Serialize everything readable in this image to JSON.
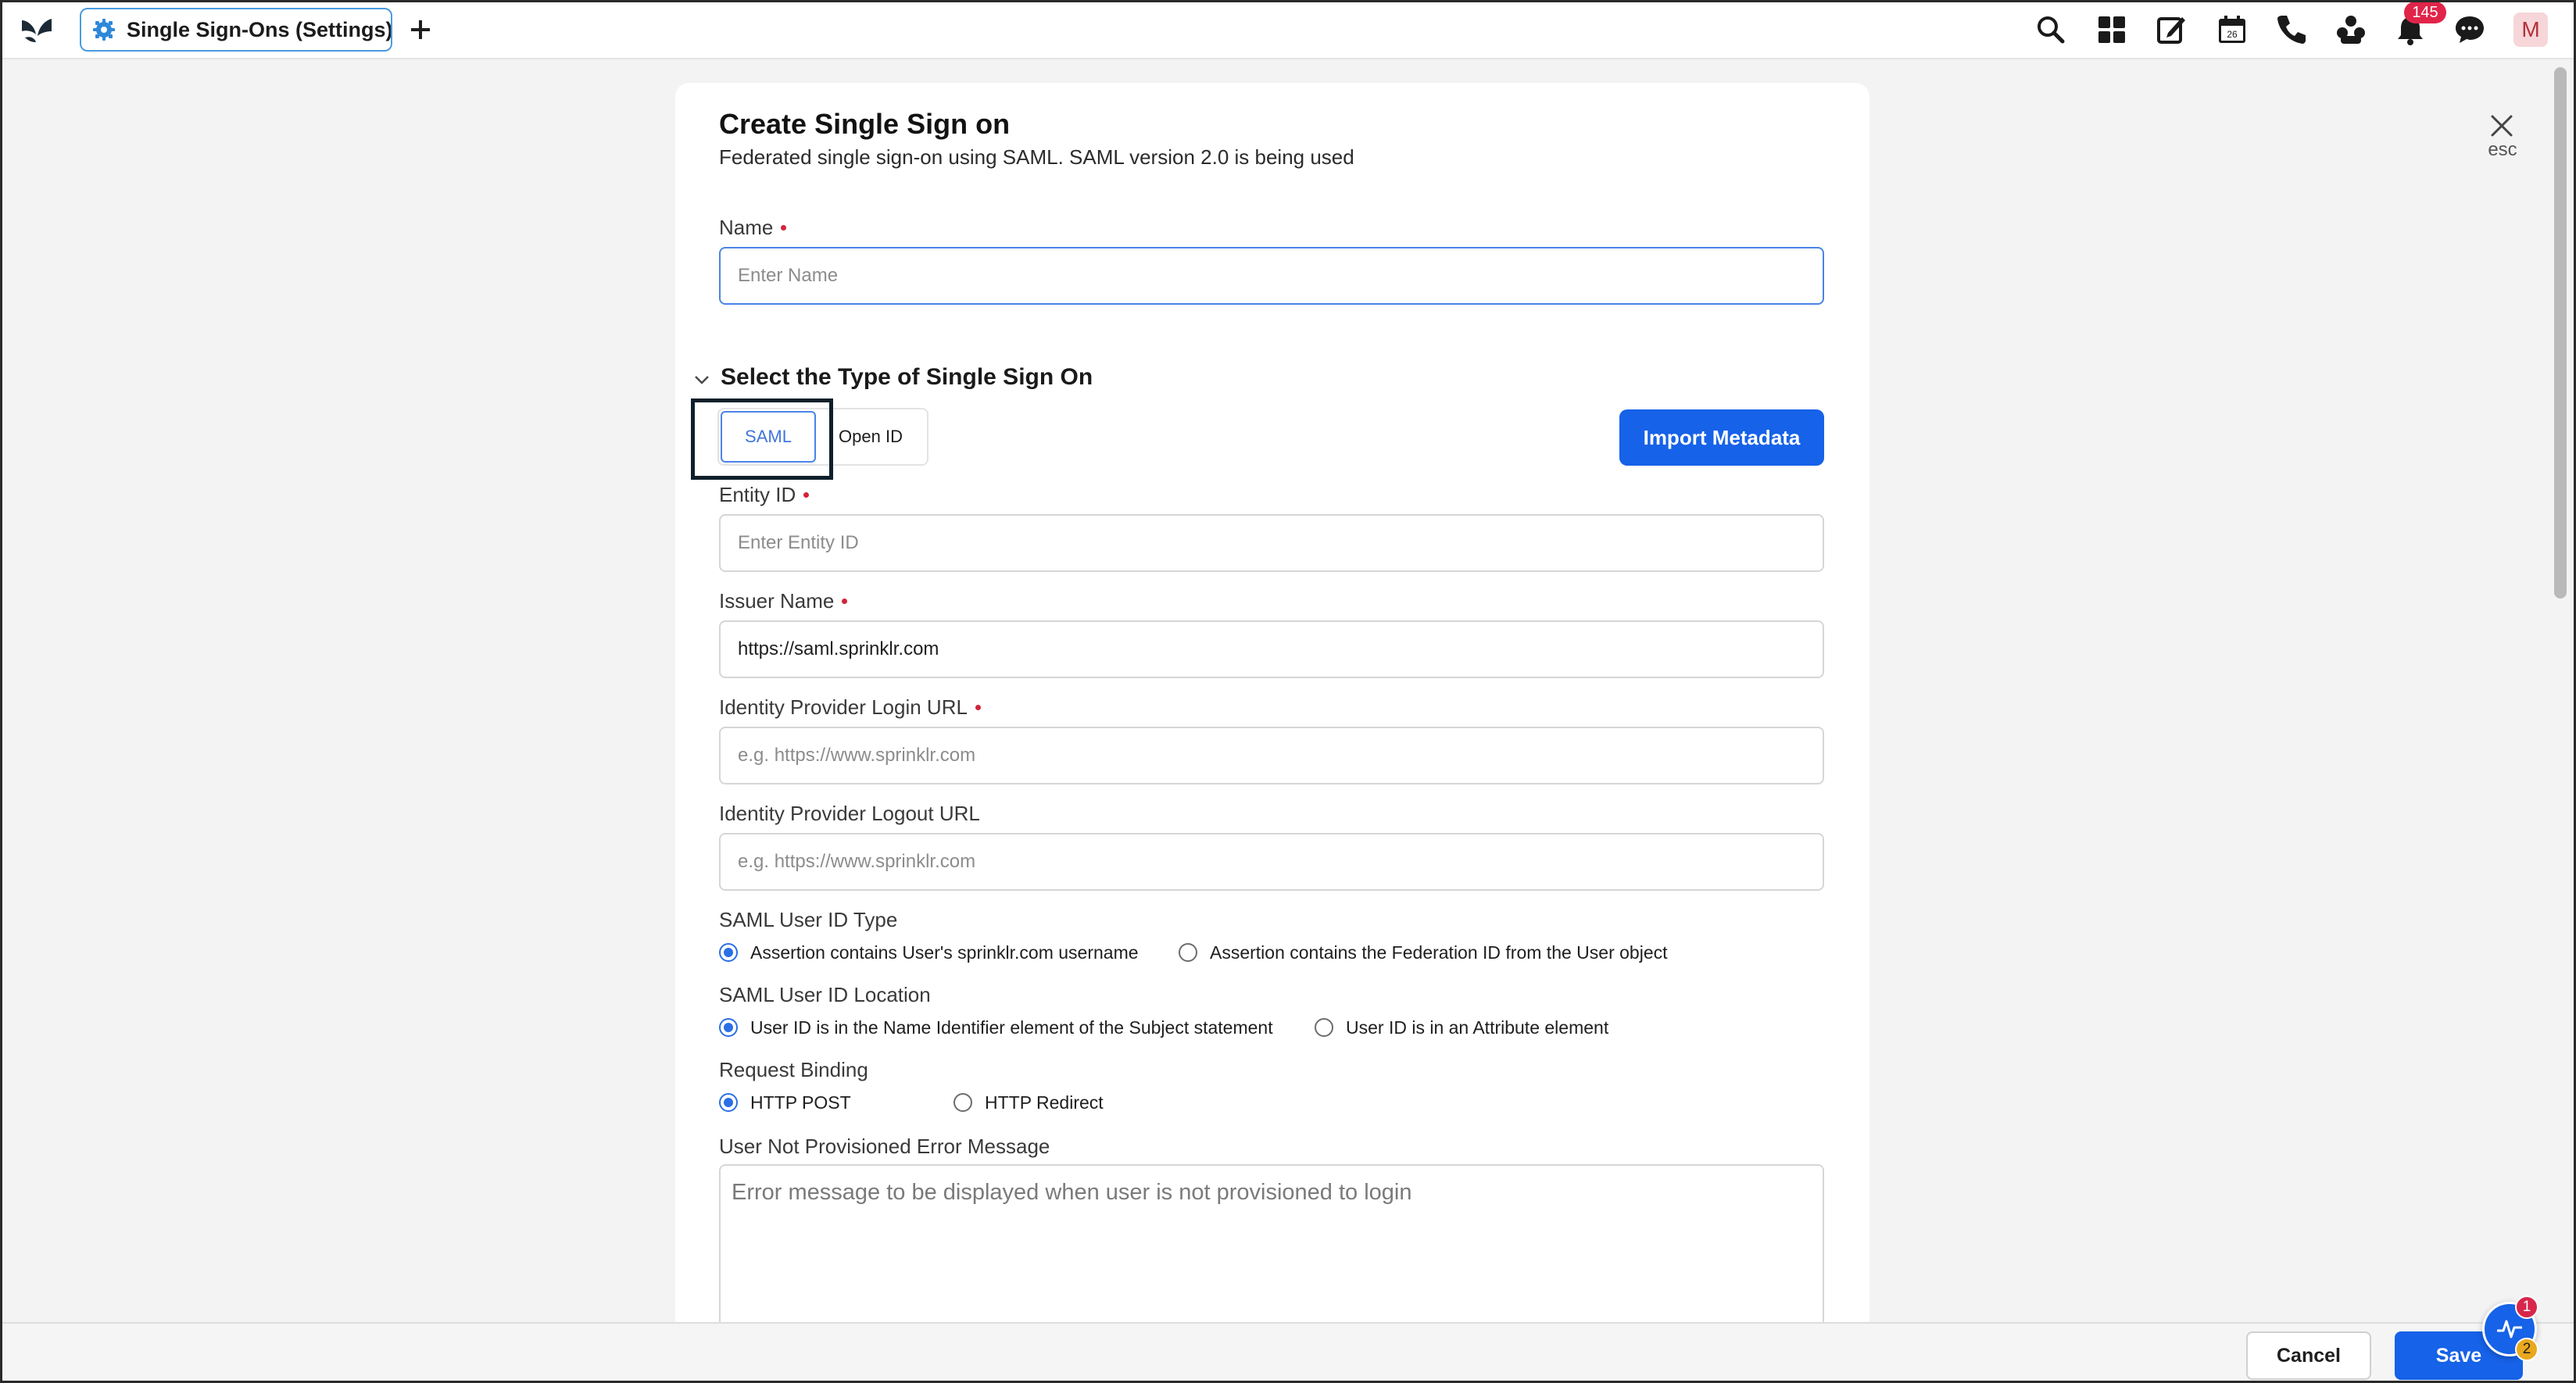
{
  "header": {
    "tab_label": "Single Sign-Ons (Settings)",
    "notification_count": "145",
    "avatar_initial": "M",
    "calendar_day": "26",
    "icons": [
      "sprinklr-logo-icon",
      "gear-icon",
      "plus-icon",
      "search-icon",
      "apps-grid-icon",
      "edit-icon",
      "calendar-icon",
      "phone-icon",
      "community-icon",
      "bell-icon",
      "chat-icon"
    ]
  },
  "dialog": {
    "close_hint": "esc",
    "title": "Create Single Sign on",
    "subtitle": "Federated single sign-on using SAML. SAML version 2.0 is being used",
    "name": {
      "label": "Name",
      "placeholder": "Enter Name",
      "value": ""
    },
    "type_section": {
      "title": "Select the Type of Single Sign On",
      "options": [
        "SAML",
        "Open ID"
      ],
      "selected": "SAML",
      "import_button": "Import Metadata"
    },
    "entity_id": {
      "label": "Entity ID",
      "placeholder": "Enter Entity ID",
      "value": ""
    },
    "issuer_name": {
      "label": "Issuer Name",
      "value": "https://saml.sprinklr.com"
    },
    "idp_login_url": {
      "label": "Identity Provider Login URL",
      "placeholder": "e.g. https://www.sprinklr.com",
      "value": ""
    },
    "idp_logout_url": {
      "label": "Identity Provider Logout URL",
      "placeholder": "e.g. https://www.sprinklr.com",
      "value": ""
    },
    "user_id_type": {
      "label": "SAML User ID Type",
      "options": [
        "Assertion contains User's sprinklr.com username",
        "Assertion contains the Federation ID from the User object"
      ],
      "selected": 0
    },
    "user_id_location": {
      "label": "SAML User ID Location",
      "options": [
        "User ID is in the Name Identifier element of the Subject statement",
        "User ID is in an Attribute element"
      ],
      "selected": 0
    },
    "request_binding": {
      "label": "Request Binding",
      "options": [
        "HTTP POST",
        "HTTP Redirect"
      ],
      "selected": 0
    },
    "error_message": {
      "label": "User Not Provisioned Error Message",
      "placeholder": "Error message to be displayed when user is not provisioned to login"
    }
  },
  "footer": {
    "cancel_label": "Cancel",
    "save_label": "Save",
    "pulse_badge_top": "1",
    "pulse_badge_bottom": "2"
  },
  "colors": {
    "accent": "#1662e8",
    "focus_border": "#4a84e8",
    "required_dot": "#d4233c",
    "badge": "#e1244a"
  }
}
